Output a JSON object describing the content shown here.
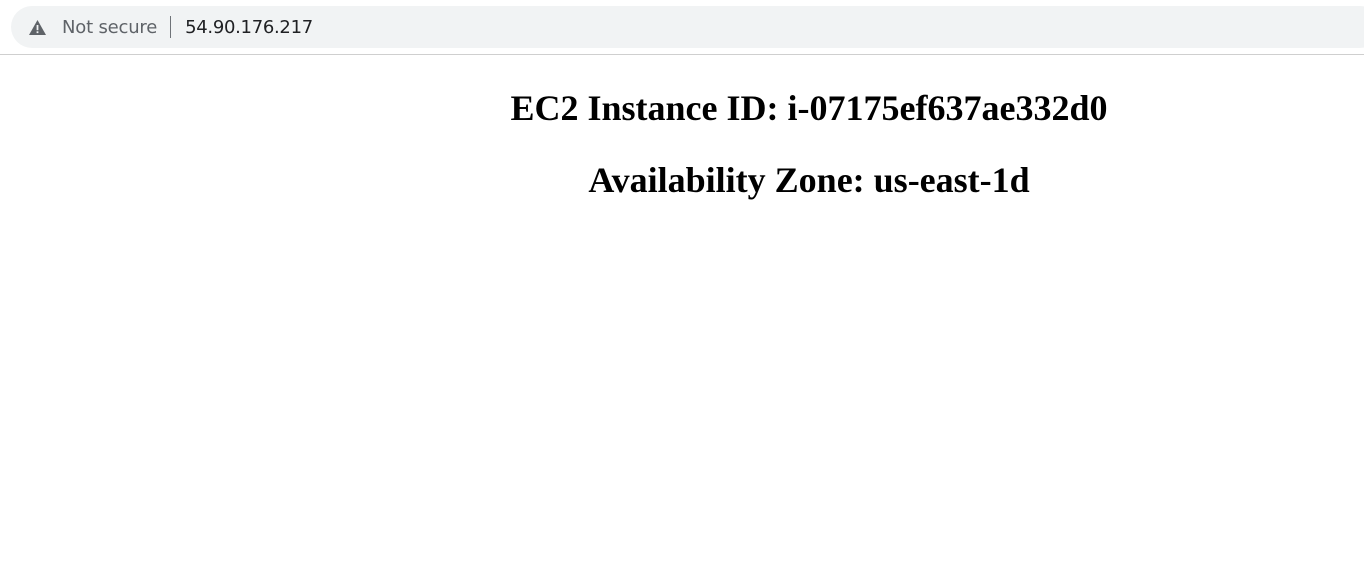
{
  "browser": {
    "security_label": "Not secure",
    "url": "54.90.176.217",
    "security_icon": "warning-triangle-icon"
  },
  "page": {
    "instance_heading": "EC2 Instance ID: i-07175ef637ae332d0",
    "zone_heading": "Availability Zone: us-east-1d"
  }
}
